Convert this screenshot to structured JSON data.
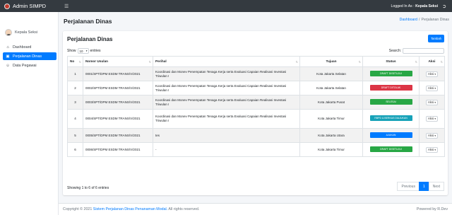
{
  "app": {
    "title": "Admin SIMPD",
    "hamburger_icon": "menu-icon"
  },
  "topbar": {
    "logged_prefix": "Logged In As :",
    "logged_user": "Kepala Seksi",
    "logout_icon": "logout-icon"
  },
  "sidebar": {
    "user_name": "Kepala Seksi",
    "items": [
      {
        "label": "Dashboard",
        "icon": "home-icon",
        "active": false
      },
      {
        "label": "Perjalanan Dinas",
        "icon": "map-icon",
        "active": true
      },
      {
        "label": "Data Pegawai",
        "icon": "users-icon",
        "active": false
      }
    ]
  },
  "page": {
    "title": "Perjalanan Dinas",
    "breadcrumb": {
      "home": "Dashboard",
      "separator": "/",
      "current": "Perjalanan Dinas"
    }
  },
  "card": {
    "title": "Perjalanan Dinas",
    "add_label": "Tambah",
    "show_label": "Show",
    "entries_value": "10",
    "entries_label": "entries",
    "search_label": "Search:",
    "search_value": ""
  },
  "table": {
    "headers": [
      "No",
      "Nomor Usulan",
      "Perihal",
      "Tujuan",
      "Status",
      "Aksi"
    ],
    "rows": [
      {
        "no": "1",
        "nomor": "0001/SPT/DPM ESDM TRANS/V/2021",
        "perihal": "Koordinasi dan Monev Penempatan Tenaga Kerja serta Evaluasi Capaian Realisasi Investasi Triwulan I",
        "tujuan": "Kota Jakarta Selatan",
        "status": "DRAFT DISETUJUI",
        "status_color": "#28a745",
        "aksi": "Aksi"
      },
      {
        "no": "2",
        "nomor": "0002/SPT/DPM ESDM TRANS/V/2021",
        "perihal": "Koordinasi dan Monev Penempatan Tenaga Kerja serta Evaluasi Capaian Realisasi Investasi Triwulan I",
        "tujuan": "Kota Jakarta Selatan",
        "status": "DRAFT DITOLAK",
        "status_color": "#dc3545",
        "aksi": "Aksi"
      },
      {
        "no": "3",
        "nomor": "0003/SPT/DPM ESDM TRANS/V/2021",
        "perihal": "Koordinasi dan Monev Penempatan Tenaga Kerja serta Evaluasi Capaian Realisasi Investasi Triwulan I",
        "tujuan": "Kota Jakarta Pusat",
        "status": "SELESAI",
        "status_color": "#28a745",
        "aksi": "Aksi"
      },
      {
        "no": "4",
        "nomor": "0004/SPT/DPM ESDM TRANS/V/2021",
        "perihal": "Koordinasi dan Monev Penempatan Tenaga Kerja serta Evaluasi Capaian Realisasi Investasi Triwulan I",
        "tujuan": "Kota Jakarta Timur",
        "status": "RBPD & BERKAS DIAJUKAN",
        "status_color": "#17a2b8",
        "aksi": "Aksi"
      },
      {
        "no": "5",
        "nomor": "0005/SPT/DPM ESDM TRANS/V/2021",
        "perihal": "tes",
        "tujuan": "Kota Jakarta Utara",
        "status": "AJUKAN",
        "status_color": "#007bff",
        "aksi": "Aksi"
      },
      {
        "no": "6",
        "nomor": "0006/SPT/DPM ESDM TRANS/V/2021",
        "perihal": "-",
        "tujuan": "Kota Jakarta Timur",
        "status": "DRAFT DISETUJUI",
        "status_color": "#28a745",
        "aksi": "Aksi"
      }
    ]
  },
  "info": "Showing 1 to 6 of 6 entries",
  "pagination": {
    "previous": "Previous",
    "current": "1",
    "next": "Next"
  },
  "footer": {
    "prefix": "Copyright © 2021",
    "link": "Sistem Perjalanan Dinas Penanaman Modal.",
    "suffix": "All rights reserved.",
    "right": "Powered by R.Dev"
  }
}
